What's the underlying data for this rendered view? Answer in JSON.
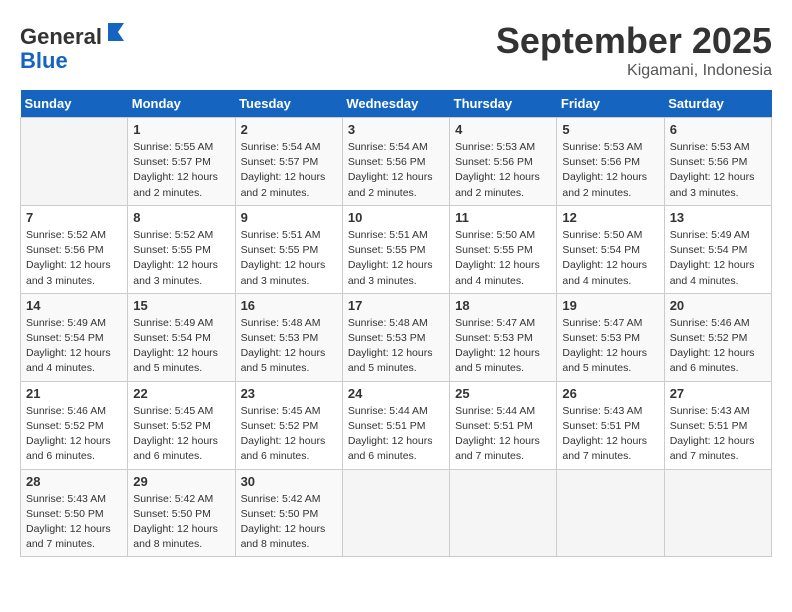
{
  "header": {
    "logo_general": "General",
    "logo_blue": "Blue",
    "month": "September 2025",
    "location": "Kigamani, Indonesia"
  },
  "weekdays": [
    "Sunday",
    "Monday",
    "Tuesday",
    "Wednesday",
    "Thursday",
    "Friday",
    "Saturday"
  ],
  "weeks": [
    [
      {
        "day": "",
        "info": ""
      },
      {
        "day": "1",
        "info": "Sunrise: 5:55 AM\nSunset: 5:57 PM\nDaylight: 12 hours\nand 2 minutes."
      },
      {
        "day": "2",
        "info": "Sunrise: 5:54 AM\nSunset: 5:57 PM\nDaylight: 12 hours\nand 2 minutes."
      },
      {
        "day": "3",
        "info": "Sunrise: 5:54 AM\nSunset: 5:56 PM\nDaylight: 12 hours\nand 2 minutes."
      },
      {
        "day": "4",
        "info": "Sunrise: 5:53 AM\nSunset: 5:56 PM\nDaylight: 12 hours\nand 2 minutes."
      },
      {
        "day": "5",
        "info": "Sunrise: 5:53 AM\nSunset: 5:56 PM\nDaylight: 12 hours\nand 2 minutes."
      },
      {
        "day": "6",
        "info": "Sunrise: 5:53 AM\nSunset: 5:56 PM\nDaylight: 12 hours\nand 3 minutes."
      }
    ],
    [
      {
        "day": "7",
        "info": "Sunrise: 5:52 AM\nSunset: 5:56 PM\nDaylight: 12 hours\nand 3 minutes."
      },
      {
        "day": "8",
        "info": "Sunrise: 5:52 AM\nSunset: 5:55 PM\nDaylight: 12 hours\nand 3 minutes."
      },
      {
        "day": "9",
        "info": "Sunrise: 5:51 AM\nSunset: 5:55 PM\nDaylight: 12 hours\nand 3 minutes."
      },
      {
        "day": "10",
        "info": "Sunrise: 5:51 AM\nSunset: 5:55 PM\nDaylight: 12 hours\nand 3 minutes."
      },
      {
        "day": "11",
        "info": "Sunrise: 5:50 AM\nSunset: 5:55 PM\nDaylight: 12 hours\nand 4 minutes."
      },
      {
        "day": "12",
        "info": "Sunrise: 5:50 AM\nSunset: 5:54 PM\nDaylight: 12 hours\nand 4 minutes."
      },
      {
        "day": "13",
        "info": "Sunrise: 5:49 AM\nSunset: 5:54 PM\nDaylight: 12 hours\nand 4 minutes."
      }
    ],
    [
      {
        "day": "14",
        "info": "Sunrise: 5:49 AM\nSunset: 5:54 PM\nDaylight: 12 hours\nand 4 minutes."
      },
      {
        "day": "15",
        "info": "Sunrise: 5:49 AM\nSunset: 5:54 PM\nDaylight: 12 hours\nand 5 minutes."
      },
      {
        "day": "16",
        "info": "Sunrise: 5:48 AM\nSunset: 5:53 PM\nDaylight: 12 hours\nand 5 minutes."
      },
      {
        "day": "17",
        "info": "Sunrise: 5:48 AM\nSunset: 5:53 PM\nDaylight: 12 hours\nand 5 minutes."
      },
      {
        "day": "18",
        "info": "Sunrise: 5:47 AM\nSunset: 5:53 PM\nDaylight: 12 hours\nand 5 minutes."
      },
      {
        "day": "19",
        "info": "Sunrise: 5:47 AM\nSunset: 5:53 PM\nDaylight: 12 hours\nand 5 minutes."
      },
      {
        "day": "20",
        "info": "Sunrise: 5:46 AM\nSunset: 5:52 PM\nDaylight: 12 hours\nand 6 minutes."
      }
    ],
    [
      {
        "day": "21",
        "info": "Sunrise: 5:46 AM\nSunset: 5:52 PM\nDaylight: 12 hours\nand 6 minutes."
      },
      {
        "day": "22",
        "info": "Sunrise: 5:45 AM\nSunset: 5:52 PM\nDaylight: 12 hours\nand 6 minutes."
      },
      {
        "day": "23",
        "info": "Sunrise: 5:45 AM\nSunset: 5:52 PM\nDaylight: 12 hours\nand 6 minutes."
      },
      {
        "day": "24",
        "info": "Sunrise: 5:44 AM\nSunset: 5:51 PM\nDaylight: 12 hours\nand 6 minutes."
      },
      {
        "day": "25",
        "info": "Sunrise: 5:44 AM\nSunset: 5:51 PM\nDaylight: 12 hours\nand 7 minutes."
      },
      {
        "day": "26",
        "info": "Sunrise: 5:43 AM\nSunset: 5:51 PM\nDaylight: 12 hours\nand 7 minutes."
      },
      {
        "day": "27",
        "info": "Sunrise: 5:43 AM\nSunset: 5:51 PM\nDaylight: 12 hours\nand 7 minutes."
      }
    ],
    [
      {
        "day": "28",
        "info": "Sunrise: 5:43 AM\nSunset: 5:50 PM\nDaylight: 12 hours\nand 7 minutes."
      },
      {
        "day": "29",
        "info": "Sunrise: 5:42 AM\nSunset: 5:50 PM\nDaylight: 12 hours\nand 8 minutes."
      },
      {
        "day": "30",
        "info": "Sunrise: 5:42 AM\nSunset: 5:50 PM\nDaylight: 12 hours\nand 8 minutes."
      },
      {
        "day": "",
        "info": ""
      },
      {
        "day": "",
        "info": ""
      },
      {
        "day": "",
        "info": ""
      },
      {
        "day": "",
        "info": ""
      }
    ]
  ]
}
